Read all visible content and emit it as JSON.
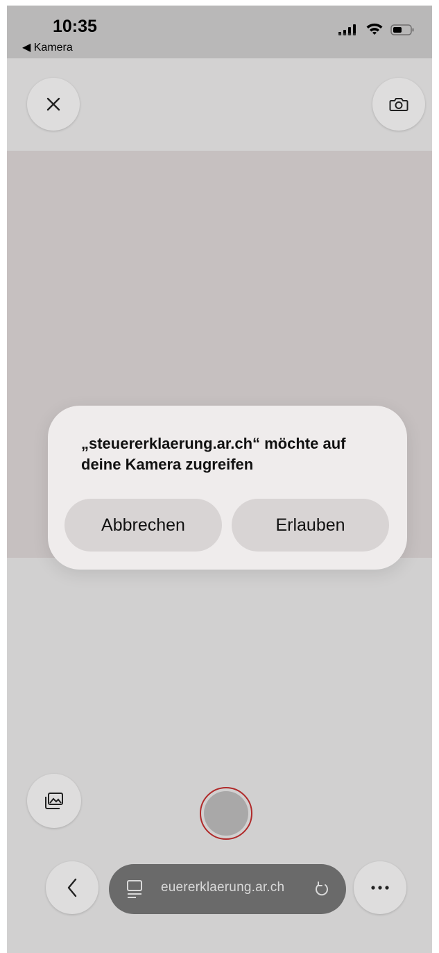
{
  "status_bar": {
    "time": "10:35",
    "back_app": "◀ Kamera",
    "signal_icon": "signal-bars-icon",
    "wifi_icon": "wifi-icon",
    "battery_icon": "battery-icon"
  },
  "top_toolbar": {
    "close_icon": "close-icon",
    "switch_camera_icon": "camera-flip-icon"
  },
  "dialog": {
    "message": "„steuererklaerung.ar.ch“ möchte auf deine Kamera zugreifen",
    "cancel_label": "Abbrechen",
    "allow_label": "Erlauben"
  },
  "bottom_controls": {
    "gallery_icon": "photo-gallery-icon",
    "shutter_icon": "shutter-button",
    "shutter_ring_color": "#b02a2a"
  },
  "browser_bar": {
    "back_icon": "chevron-left-icon",
    "url": "euererklaerung.ar.ch",
    "tab_icon": "page-icon",
    "reload_icon": "reload-icon",
    "more_icon": "more-dots-icon"
  },
  "colors": {
    "status_bar_bg": "#b9b8b8",
    "viewfinder_bg": "#c6c0c0",
    "dialog_bg": "#efecec",
    "url_bar_bg": "#6a6a6a"
  }
}
